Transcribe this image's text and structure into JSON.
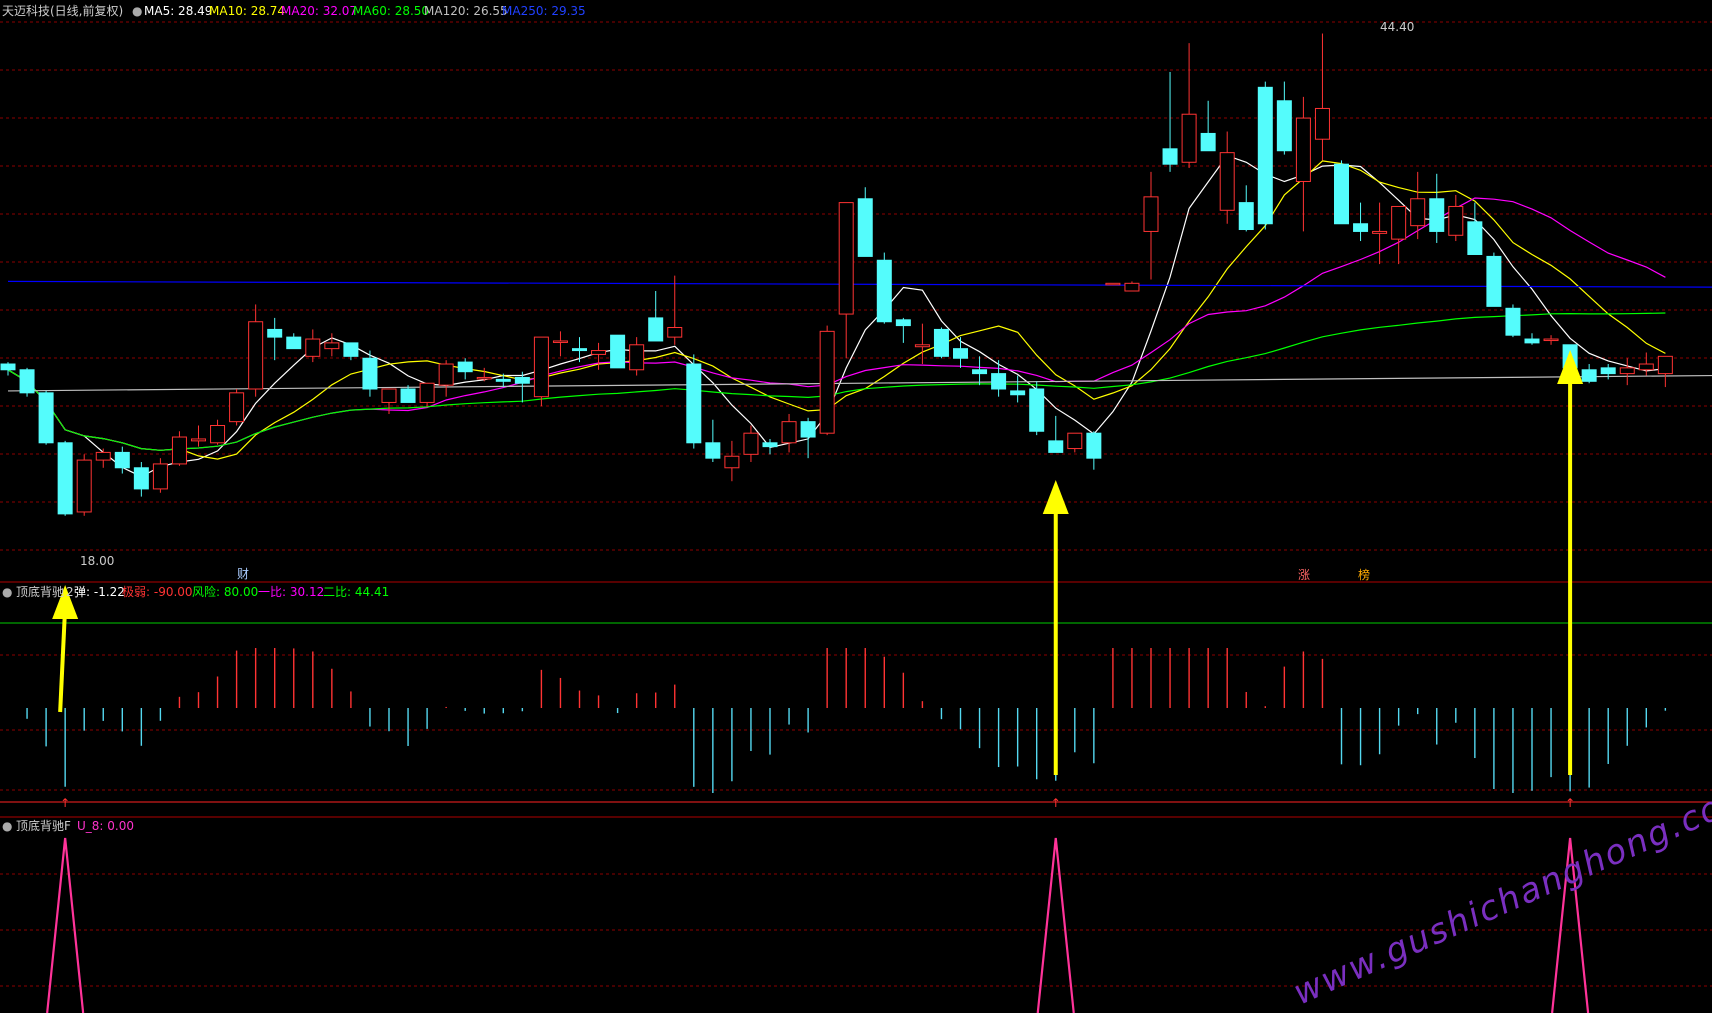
{
  "header": {
    "stock_title": "天迈科技(日线,前复权)",
    "ma": [
      {
        "label": "MA5: 28.49",
        "color": "#ffffff"
      },
      {
        "label": "MA10: 28.74",
        "color": "#ffff00"
      },
      {
        "label": "MA20: 32.07",
        "color": "#ff00ff"
      },
      {
        "label": "MA60: 28.50",
        "color": "#00ff00"
      },
      {
        "label": "MA120: 26.55",
        "color": "#c0c0c0"
      },
      {
        "label": "MA250: 29.35",
        "color": "#0000ff"
      }
    ]
  },
  "colors": {
    "background": "#000000",
    "up_candle": "#ff3333",
    "down_candle": "#54fcfc",
    "grid": "#8b0000",
    "arrow": "#ffff00",
    "peak_line": "#ff3399"
  },
  "price_annotations": {
    "high": "44.40",
    "low": "18.00"
  },
  "markers": {
    "cai": "财",
    "zhang": "涨",
    "bang": "榜"
  },
  "indicator1": {
    "name": "顶底背驰",
    "name_suffix": "2",
    "value_label": "弹: -1.22",
    "items": [
      {
        "label": "极弱: -90.00",
        "color": "#ff3333"
      },
      {
        "label": "风险: 80.00",
        "color": "#00ff00"
      },
      {
        "label": "一比: 30.12",
        "color": "#ff00ff"
      },
      {
        "label": "二比: 44.41",
        "color": "#00ff00"
      }
    ]
  },
  "indicator2": {
    "name": "顶底背驰F",
    "value_label": "U_8: 0.00"
  },
  "watermark": "www.gushichanghong.com",
  "chart_data": {
    "type": "candlestick",
    "candles": [
      [
        27.2,
        27.3,
        26.6,
        26.9
      ],
      [
        26.9,
        27.0,
        25.5,
        25.7
      ],
      [
        25.7,
        25.8,
        23.0,
        23.1
      ],
      [
        23.1,
        23.2,
        19.3,
        19.4
      ],
      [
        19.5,
        22.5,
        19.3,
        22.2
      ],
      [
        22.2,
        22.8,
        21.8,
        22.6
      ],
      [
        22.6,
        22.9,
        21.5,
        21.8
      ],
      [
        21.8,
        22.1,
        20.3,
        20.7
      ],
      [
        20.7,
        22.3,
        20.5,
        22.0
      ],
      [
        22.0,
        23.7,
        21.9,
        23.4
      ],
      [
        23.2,
        24.0,
        22.9,
        23.3
      ],
      [
        23.1,
        24.3,
        23.0,
        24.0
      ],
      [
        24.2,
        25.9,
        24.0,
        25.7
      ],
      [
        25.9,
        30.3,
        25.5,
        29.4
      ],
      [
        29.0,
        29.6,
        27.4,
        28.6
      ],
      [
        28.6,
        28.8,
        28.0,
        28.0
      ],
      [
        27.6,
        29.0,
        27.3,
        28.5
      ],
      [
        28.0,
        28.8,
        27.6,
        28.3
      ],
      [
        28.3,
        28.3,
        27.4,
        27.6
      ],
      [
        27.5,
        27.9,
        25.5,
        25.9
      ],
      [
        25.2,
        25.9,
        24.6,
        25.9
      ],
      [
        25.9,
        26.1,
        25.2,
        25.2
      ],
      [
        25.2,
        26.2,
        25.0,
        26.2
      ],
      [
        26.1,
        27.4,
        25.5,
        27.2
      ],
      [
        27.3,
        27.5,
        26.4,
        26.8
      ],
      [
        26.5,
        27.0,
        26.3,
        26.5
      ],
      [
        26.4,
        26.7,
        26.0,
        26.3
      ],
      [
        26.5,
        26.8,
        25.2,
        26.2
      ],
      [
        25.5,
        28.6,
        25.0,
        28.6
      ],
      [
        28.4,
        28.9,
        27.6,
        28.4
      ],
      [
        28.0,
        28.6,
        27.3,
        27.9
      ],
      [
        27.7,
        28.3,
        26.9,
        27.9
      ],
      [
        28.7,
        28.7,
        27.0,
        27.0
      ],
      [
        26.9,
        28.6,
        26.6,
        28.2
      ],
      [
        29.6,
        31.0,
        29.0,
        28.4
      ],
      [
        28.6,
        31.8,
        28.2,
        29.1
      ],
      [
        27.2,
        27.7,
        22.8,
        23.1
      ],
      [
        23.1,
        24.3,
        22.1,
        22.3
      ],
      [
        21.8,
        23.2,
        21.1,
        22.4
      ],
      [
        22.5,
        24.0,
        22.1,
        23.6
      ],
      [
        23.1,
        23.3,
        22.5,
        22.9
      ],
      [
        23.1,
        24.6,
        22.6,
        24.2
      ],
      [
        24.2,
        24.4,
        22.3,
        23.4
      ],
      [
        23.6,
        29.2,
        23.5,
        28.9
      ],
      [
        29.8,
        35.3,
        27.5,
        35.6
      ],
      [
        35.8,
        36.4,
        32.8,
        32.8
      ],
      [
        32.6,
        33.0,
        29.3,
        29.4
      ],
      [
        29.5,
        29.6,
        28.3,
        29.2
      ],
      [
        28.1,
        29.3,
        27.2,
        28.2
      ],
      [
        29.0,
        29.1,
        27.5,
        27.6
      ],
      [
        28.0,
        28.6,
        27.0,
        27.5
      ],
      [
        26.9,
        27.6,
        26.1,
        26.7
      ],
      [
        26.7,
        27.4,
        25.5,
        25.9
      ],
      [
        25.8,
        26.6,
        25.2,
        25.6
      ],
      [
        25.9,
        26.3,
        23.5,
        23.7
      ],
      [
        23.2,
        24.5,
        22.6,
        22.6
      ],
      [
        22.8,
        23.6,
        22.6,
        23.6
      ],
      [
        23.6,
        23.7,
        21.7,
        22.3
      ],
      [
        31.4,
        31.4,
        31.4,
        31.4
      ],
      [
        31.0,
        31.5,
        31.0,
        31.4
      ],
      [
        34.1,
        37.2,
        31.6,
        35.9
      ],
      [
        38.4,
        42.4,
        37.2,
        37.6
      ],
      [
        37.7,
        43.9,
        37.4,
        40.2
      ],
      [
        39.2,
        40.9,
        38.3,
        38.3
      ],
      [
        35.2,
        39.3,
        34.5,
        38.2
      ],
      [
        35.6,
        36.5,
        34.1,
        34.2
      ],
      [
        41.6,
        41.9,
        34.2,
        34.5
      ],
      [
        40.9,
        41.9,
        38.1,
        38.3
      ],
      [
        36.7,
        41.1,
        34.1,
        40.0
      ],
      [
        38.9,
        44.4,
        37.8,
        40.5
      ],
      [
        37.6,
        37.8,
        34.6,
        34.5
      ],
      [
        34.5,
        35.6,
        33.6,
        34.1
      ],
      [
        34.0,
        35.6,
        32.4,
        34.1
      ],
      [
        33.7,
        34.5,
        32.4,
        35.4
      ],
      [
        34.4,
        37.2,
        33.7,
        35.8
      ],
      [
        35.8,
        37.1,
        33.5,
        34.1
      ],
      [
        33.9,
        36.0,
        33.6,
        35.4
      ],
      [
        34.6,
        35.6,
        32.9,
        32.9
      ],
      [
        32.8,
        33.0,
        30.2,
        30.2
      ],
      [
        30.1,
        30.3,
        28.6,
        28.7
      ],
      [
        28.5,
        28.8,
        28.2,
        28.3
      ],
      [
        28.5,
        28.7,
        28.2,
        28.5
      ],
      [
        28.2,
        28.2,
        27.0,
        27.0
      ],
      [
        26.9,
        27.2,
        26.2,
        26.3
      ],
      [
        27.0,
        27.2,
        26.4,
        26.7
      ],
      [
        26.7,
        27.5,
        26.1,
        27.0
      ],
      [
        26.9,
        27.8,
        26.6,
        27.2
      ],
      [
        26.7,
        27.6,
        26.0,
        27.6
      ]
    ],
    "ma_series": [
      "MA5",
      "MA10",
      "MA20",
      "MA60",
      "MA120",
      "MA250"
    ],
    "high_label": 44.4,
    "low_label": 18.0,
    "signals": [
      3,
      55,
      82
    ]
  }
}
